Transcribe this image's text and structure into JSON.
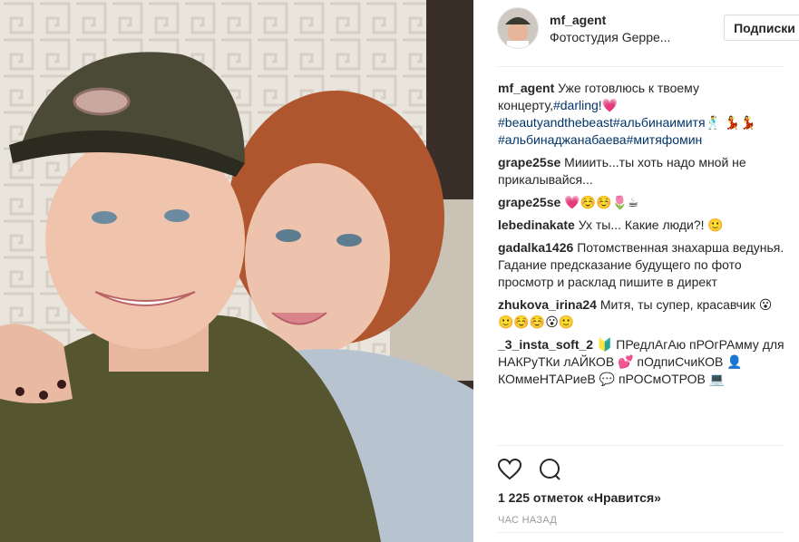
{
  "post": {
    "username": "mf_agent",
    "location": "Фотостудия Geppe...",
    "follow_label": "Подписки",
    "likes": "1 225 отметок «Нравится»",
    "time": "ЧАС НАЗАД"
  },
  "caption": {
    "user": "mf_agent",
    "text": "Уже готовлюсь к твоему концерту,",
    "tag1": "#darling!",
    "emoji1": "💗",
    "line2": "#beautyandthebeast#альбинаимитя",
    "emoji2": "🕺 💃💃",
    "line3": "#альбинаджанабаева#митяфомин"
  },
  "comments": [
    {
      "user": "grape25se",
      "text": "Мииить...ты хоть надо мной не прикалывайся..."
    },
    {
      "user": "grape25se",
      "text": "💗☺️☺️🌷☕"
    },
    {
      "user": "lebedinakate",
      "text": "Ух ты... Какие люди?! 🙂"
    },
    {
      "user": "gadalka1426",
      "text": "Потомственная знахарша ведунья. Гадание предсказание будущего по фото просмотр и расклад пишите в директ"
    },
    {
      "user": "zhukova_irina24",
      "text": "Митя, ты супер, красавчик 😮🙂☺️☺️😮🙂"
    },
    {
      "user": "_3_insta_soft_2",
      "text": "🔰 ПРедлАгАю пРОгРАмму для НАКРуТКи лАЙКОВ 💕 пОдпиСчиКОВ 👤 КОммеНТАРиеВ 💬 пРОСмОТРОВ 💻"
    }
  ]
}
